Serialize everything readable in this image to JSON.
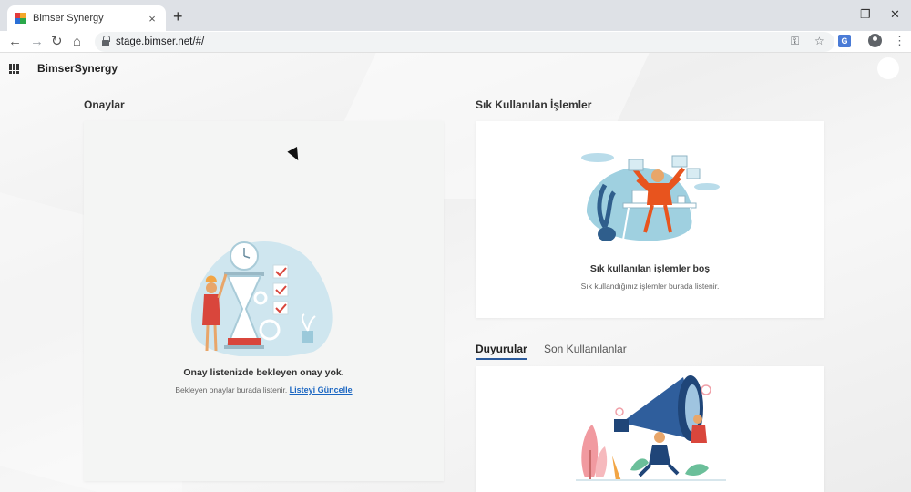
{
  "browser": {
    "tab_title": "Bimser Synergy",
    "tab_close": "×",
    "new_tab": "+",
    "url": "stage.bimser.net/#/",
    "minimize": "—",
    "restore": "❐",
    "close": "✕",
    "back": "←",
    "forward": "→",
    "reload": "↻",
    "home": "⌂",
    "key_icon": "⚿",
    "star_icon": "☆",
    "menu_icon": "⋮",
    "translate_glyph": "G"
  },
  "app": {
    "brand": "BimserSynergy",
    "approvals": {
      "title": "Onaylar",
      "empty_title": "Onay listenizde bekleyen onay yok.",
      "empty_sub": "Bekleyen onaylar burada listenir.",
      "refresh_link": "Listeyi Güncelle"
    },
    "frequent": {
      "title": "Sık Kullanılan İşlemler",
      "empty_title": "Sık kullanılan işlemler boş",
      "empty_sub": "Sık kullandığınız işlemler burada listenir."
    },
    "tabs": [
      {
        "label": "Duyurular",
        "active": true
      },
      {
        "label": "Son Kullanılanlar",
        "active": false
      }
    ]
  },
  "colors": {
    "accent": "#1a66c2",
    "tab_underline": "#2a5a9c",
    "illustration_blue": "#b9dcea",
    "illustration_red": "#d9463c"
  }
}
